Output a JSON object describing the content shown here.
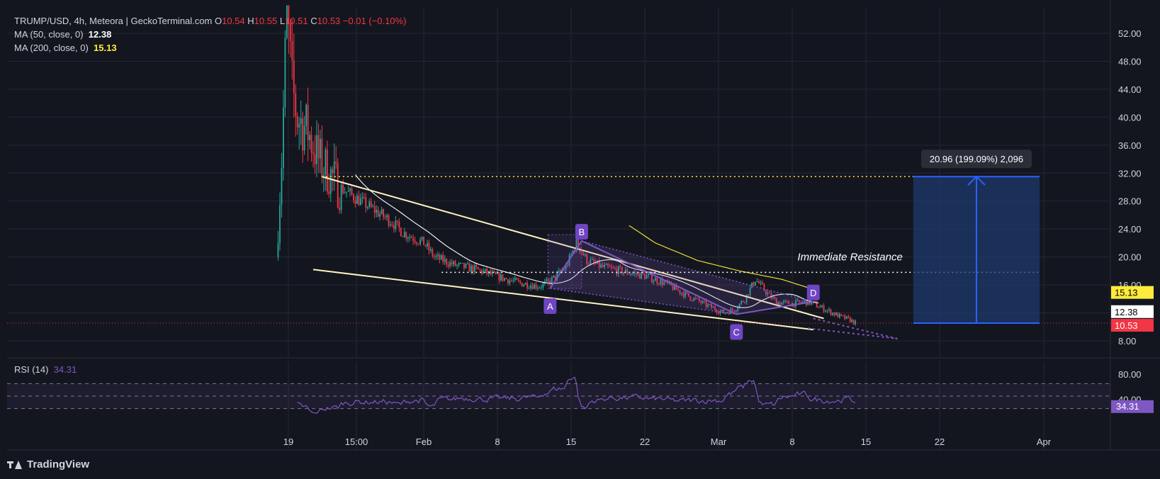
{
  "legend": {
    "pair": "TRUMP/USD, 4h, Meteora | GeckoTerminal.com",
    "o_label": "O",
    "o_value": "10.54",
    "h_label": "H",
    "h_value": "10.55",
    "l_label": "L",
    "l_value": "10.51",
    "c_label": "C",
    "c_value": "10.53",
    "change": "−0.01 (−0.10%)",
    "ma50_label": "MA (50, close, 0)",
    "ma50_value": "12.38",
    "ma200_label": "MA (200, close, 0)",
    "ma200_value": "15.13"
  },
  "rsi_legend": {
    "label": "RSI (14)",
    "value": "34.31"
  },
  "branding": {
    "text": "TradingView"
  },
  "colors": {
    "background": "#14161f",
    "grid": "#232633",
    "up": "#26a69a",
    "down": "#f23645",
    "ma50": "#ffffff",
    "ma200": "#ffeb3b",
    "trendline": "#fff3c4",
    "pattern": "#7e57c2",
    "target_fill": "#1e3a6e",
    "target_line": "#2962ff",
    "rsi": "#7e57c2"
  },
  "chart_data": {
    "type": "candlestick",
    "x_ticks": [
      "19",
      "15:00",
      "Feb",
      "8",
      "15",
      "22",
      "Mar",
      "8",
      "15",
      "22",
      "Apr"
    ],
    "y_ticks": [
      "52.00",
      "48.00",
      "44.00",
      "40.00",
      "36.00",
      "32.00",
      "28.00",
      "24.00",
      "20.00",
      "16.00",
      "12.00",
      "8.00"
    ],
    "price_tags": [
      {
        "label": "15.13",
        "value": 15.13,
        "series": "MA 200"
      },
      {
        "label": "12.38",
        "value": 12.38,
        "series": "MA 50"
      },
      {
        "label": "10.53",
        "value": 10.53,
        "series": "Last price"
      }
    ],
    "pattern_points": [
      {
        "label": "A",
        "date": "Feb 12",
        "price": 15.5
      },
      {
        "label": "B",
        "date": "Feb 15",
        "price": 22.3
      },
      {
        "label": "C",
        "date": "Mar 1",
        "price": 11.8
      },
      {
        "label": "D",
        "date": "Mar 7",
        "price": 13.6
      }
    ],
    "annotations": {
      "immediate_resistance": {
        "text": "Immediate Resistance",
        "price": 17.8
      },
      "resistance_high": {
        "price": 31.5
      },
      "measurement": {
        "text": "20.96 (199.09%) 2,096",
        "from": 10.53,
        "to": 31.5
      }
    },
    "rsi": {
      "y_ticks": [
        "80.00",
        "40.00"
      ],
      "upper_band": 70,
      "lower_band": 30,
      "midline": 50,
      "last_value": "34.31"
    }
  }
}
